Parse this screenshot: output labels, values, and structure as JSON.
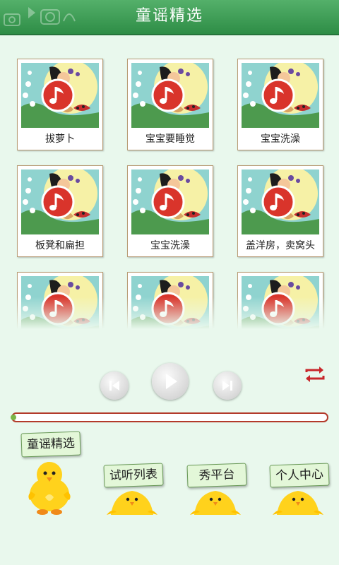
{
  "header": {
    "title": "童谣精选"
  },
  "songs": [
    {
      "title": "拔萝卜"
    },
    {
      "title": "宝宝要睡觉"
    },
    {
      "title": "宝宝洗澡"
    },
    {
      "title": "板凳和扁担"
    },
    {
      "title": "宝宝洗澡"
    },
    {
      "title": "盖洋房，卖窝头"
    },
    {
      "title": ""
    },
    {
      "title": ""
    },
    {
      "title": ""
    }
  ],
  "player": {
    "progress": 0.0,
    "repeat_icon": "repeat-icon"
  },
  "tabs": [
    {
      "label": "童谣精选",
      "active": true
    },
    {
      "label": "试听列表",
      "active": false
    },
    {
      "label": "秀平台",
      "active": false
    },
    {
      "label": "个人中心",
      "active": false
    }
  ],
  "colors": {
    "header": "#3a9a52",
    "background": "#e9f8ed",
    "note_badge": "#d9342b",
    "progress_border": "#b33a2a",
    "progress_fill": "#7ab648"
  }
}
